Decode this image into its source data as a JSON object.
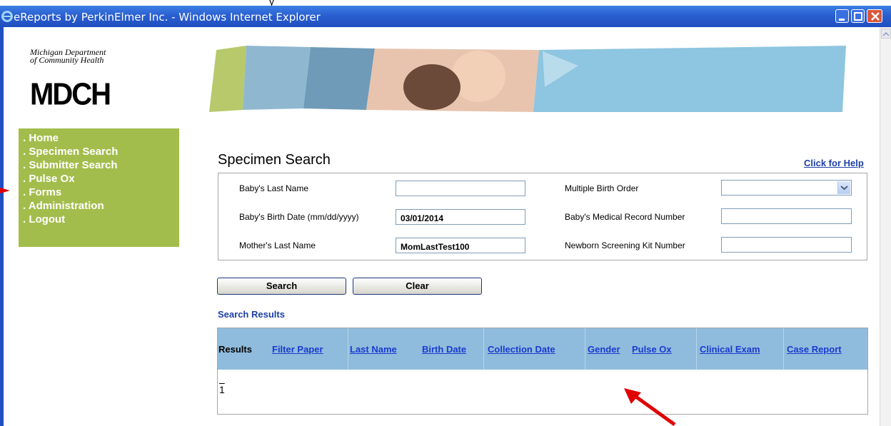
{
  "window": {
    "title": "eReports by PerkinElmer Inc. - Windows Internet Explorer"
  },
  "logo": {
    "line1": "Michigan Department",
    "line2": "of Community Health",
    "mark": "MDCH"
  },
  "nav": {
    "items": [
      ". Home",
      ". Specimen Search",
      ". Submitter Search",
      ". Pulse Ox",
      ". Forms",
      ". Administration",
      ". Logout"
    ]
  },
  "page": {
    "heading": "Specimen Search",
    "help_link": "Click for Help"
  },
  "form": {
    "baby_last_name": {
      "label": "Baby's Last Name",
      "value": ""
    },
    "baby_birth_date": {
      "label": "Baby's Birth Date  (mm/dd/yyyy)",
      "value": "03/01/2014"
    },
    "mother_last_name": {
      "label": "Mother's Last Name",
      "value": "MomLastTest100"
    },
    "multiple_birth_order": {
      "label": "Multiple Birth Order",
      "value": ""
    },
    "medical_record_number": {
      "label": "Baby's Medical Record Number",
      "value": ""
    },
    "kit_number": {
      "label": "Newborn Screening Kit Number",
      "value": ""
    }
  },
  "buttons": {
    "search": "Search",
    "clear": "Clear"
  },
  "results": {
    "title": "Search Results",
    "columns": [
      "Results",
      "Filter Paper",
      "Last Name",
      "Birth Date",
      "Collection Date",
      "Gender",
      "Pulse Ox",
      "Clinical Exam",
      "Case Report"
    ],
    "page": "1"
  },
  "colors": {
    "nav_bg": "#a3bd4c",
    "header_bg": "#8fbcdc",
    "link": "#1a3ad0",
    "annotation_arrow": "#e00000"
  }
}
